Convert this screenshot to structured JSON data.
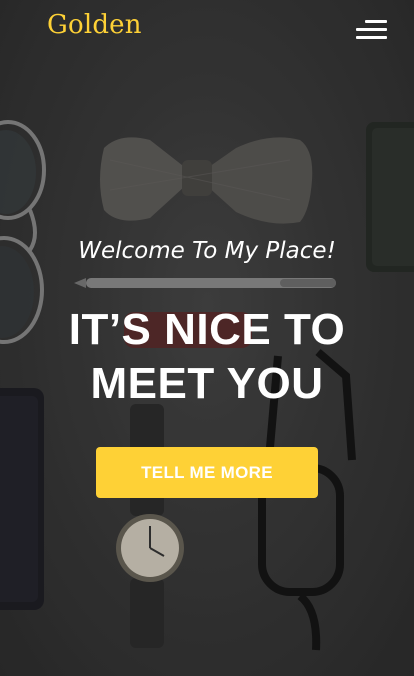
{
  "navbar": {
    "brand": "Golden",
    "menu_icon": "hamburger-menu-icon"
  },
  "hero": {
    "subheading": "Welcome To My Place!",
    "heading_line1": "IT’S NICE TO",
    "heading_line2": "MEET YOU",
    "cta_label": "TELL ME MORE"
  },
  "colors": {
    "accent": "#fed136",
    "text": "#ffffff",
    "background": "#383838"
  }
}
